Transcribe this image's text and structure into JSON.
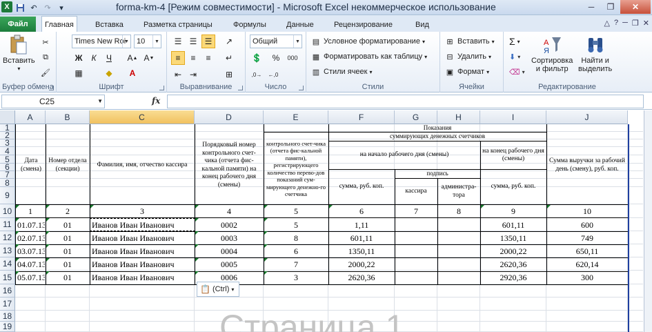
{
  "window": {
    "title": "forma-km-4  [Режим совместимости]  -  Microsoft Excel некоммерческое использование",
    "app_icon": "X",
    "minimize": "─",
    "restore": "❐",
    "close": "✕"
  },
  "tabs": {
    "file": "Файл",
    "items": [
      "Главная",
      "Вставка",
      "Разметка страницы",
      "Формулы",
      "Данные",
      "Рецензирование",
      "Вид"
    ]
  },
  "ribbon": {
    "clipboard": {
      "label": "Буфер обмена",
      "paste": "Вставить"
    },
    "font": {
      "label": "Шрифт",
      "font_name": "Times New Roi",
      "font_size": "10"
    },
    "alignment": {
      "label": "Выравнивание"
    },
    "number": {
      "label": "Число",
      "format": "Общий"
    },
    "styles": {
      "label": "Стили",
      "cond_format": "Условное форматирование",
      "format_table": "Форматировать как таблицу",
      "cell_styles": "Стили ячеек"
    },
    "cells": {
      "label": "Ячейки",
      "insert": "Вставить",
      "delete": "Удалить",
      "format": "Формат"
    },
    "editing": {
      "label": "Редактирование",
      "sort": "Сортировка\nи фильтр",
      "find": "Найти и\nвыделить"
    }
  },
  "formula_bar": {
    "name_box": "C25",
    "fx": "fx",
    "value": ""
  },
  "columns": [
    "A",
    "B",
    "C",
    "D",
    "E",
    "F",
    "G",
    "H",
    "I",
    "J"
  ],
  "rows": [
    "1",
    "2",
    "3",
    "4",
    "5",
    "6",
    "7",
    "8",
    "9",
    "10",
    "11",
    "12",
    "13",
    "14",
    "15",
    "16",
    "17",
    "18",
    "19"
  ],
  "headers": {
    "date": "Дата (смена)",
    "dept": "Номер отдела (секции)",
    "fio": "Фамилия, имя, отчество кассира",
    "serial": "Порядковый номер контрольного счет-чика (отчета фис-кальной памяти) на конец рабочего дня (смены)",
    "control": "контрольного счет-чика (отчета фис-кальной памяти), регистрирующего количество перево-дов показаний сум-мирующего денежно-го счетчика",
    "readings": "Показания",
    "summing": "суммирующих денежных счетчиков",
    "start": "на начало рабочего дня (смены)",
    "end": "на конец рабочего дня (смены)",
    "sign": "подпись",
    "sum1": "сумма, руб. коп.",
    "cashier": "кассира",
    "admin": "администра-тора",
    "sum2": "сумма, руб. коп.",
    "revenue": "Сумма выручки за рабочий день (смену), руб. коп."
  },
  "col_numbers": [
    "1",
    "2",
    "3",
    "4",
    "5",
    "6",
    "7",
    "8",
    "9",
    "10"
  ],
  "table_rows": [
    {
      "date": "01.07.13",
      "dept": "01",
      "fio": "Иванов Иван Иванович",
      "serial": "0002",
      "control": "5",
      "start": "1,11",
      "cashier": "",
      "admin": "",
      "end": "601,11",
      "revenue": "600"
    },
    {
      "date": "02.07.13",
      "dept": "01",
      "fio": "Иванов Иван Иванович",
      "serial": "0003",
      "control": "8",
      "start": "601,11",
      "cashier": "",
      "admin": "",
      "end": "1350,11",
      "revenue": "749"
    },
    {
      "date": "03.07.13",
      "dept": "01",
      "fio": "Иванов Иван Иванович",
      "serial": "0004",
      "control": "6",
      "start": "1350,11",
      "cashier": "",
      "admin": "",
      "end": "2000,22",
      "revenue": "650,11"
    },
    {
      "date": "04.07.13",
      "dept": "01",
      "fio": "Иванов Иван Иванович",
      "serial": "0005",
      "control": "7",
      "start": "2000,22",
      "cashier": "",
      "admin": "",
      "end": "2620,36",
      "revenue": "620,14"
    },
    {
      "date": "05.07.13",
      "dept": "01",
      "fio": "Иванов Иван Иванович",
      "serial": "0006",
      "control": "3",
      "start": "2620,36",
      "cashier": "",
      "admin": "",
      "end": "2920,36",
      "revenue": "300"
    }
  ],
  "paste_tag": "(Ctrl)",
  "watermark": "Страница 1"
}
